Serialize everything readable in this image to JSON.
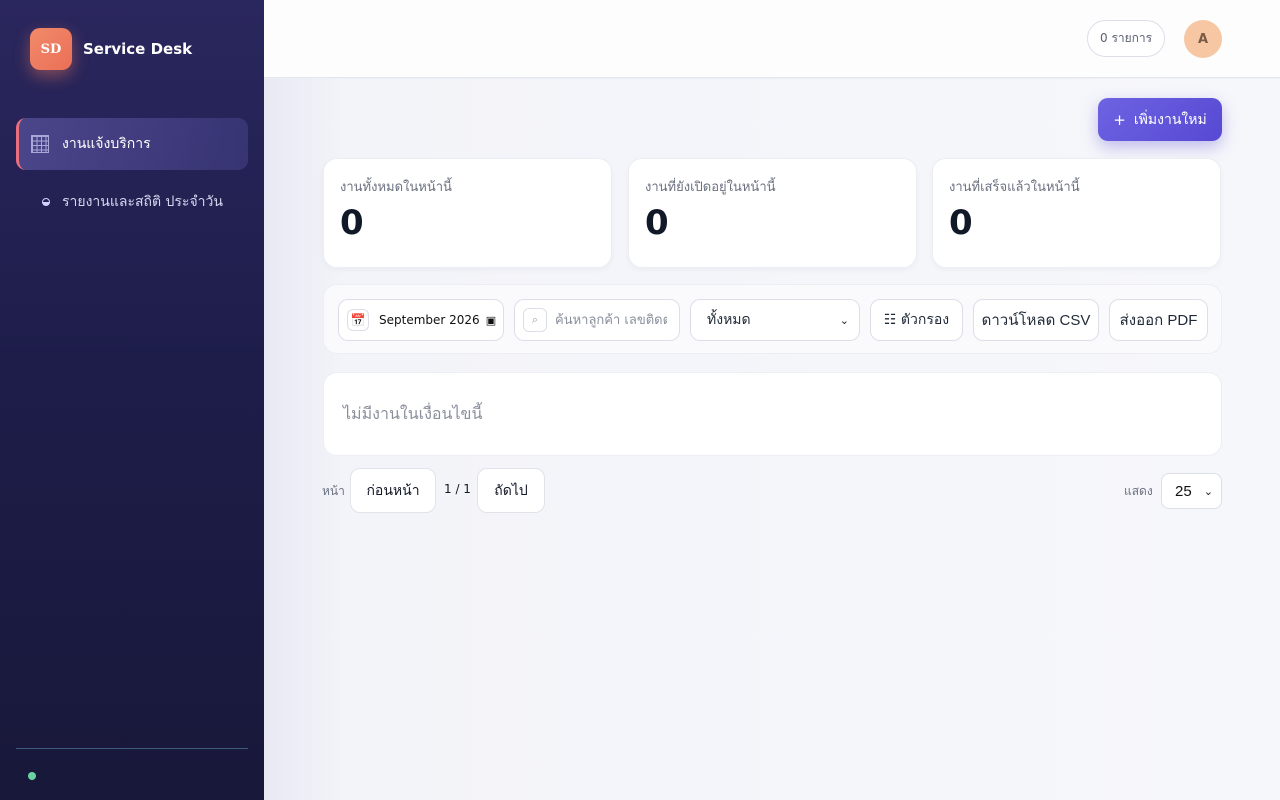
{
  "app": {
    "logo_text": "SD",
    "title": "Service Desk"
  },
  "sidebar": {
    "items": [
      {
        "label": "งานแจ้งบริการ",
        "icon": "grid-icon",
        "active": true
      },
      {
        "label": "รายงานและสถิติ ประจำวัน",
        "icon": "half-circle-icon",
        "active": false
      }
    ],
    "status_color": "#69d3a5"
  },
  "header": {
    "count_label": "0 รายการ",
    "avatar_initial": "A"
  },
  "actions": {
    "add_icon": "+",
    "add_label": "เพิ่มงานใหม่"
  },
  "stats": [
    {
      "label": "งานทั้งหมดในหน้านี้",
      "value": "0"
    },
    {
      "label": "งานที่ยังเปิดอยู่ในหน้านี้",
      "value": "0"
    },
    {
      "label": "งานที่เสร็จแล้วในหน้านี้",
      "value": "0"
    }
  ],
  "toolbar": {
    "date_value": "September 2026",
    "search_placeholder": "ค้นหาลูกค้า เลขติดตาม",
    "status_select": "ทั้งหมด",
    "filter_label": "☷ ตัวกรอง",
    "csv_label": "ดาวน์โหลด CSV",
    "pdf_label": "ส่งออก PDF"
  },
  "empty_message": "ไม่มีงานในเงื่อนไขนี้",
  "pagination": {
    "page_label": "หน้า",
    "prev_label": "ก่อนหน้า",
    "page_indicator": "1 / 1",
    "next_label": "ถัดไป",
    "show_label": "แสดง",
    "page_size": "25"
  },
  "colors": {
    "accent": "#5b4fd8",
    "brand": "#ee7b60",
    "sidebar_bg": "#1e1d4a"
  }
}
